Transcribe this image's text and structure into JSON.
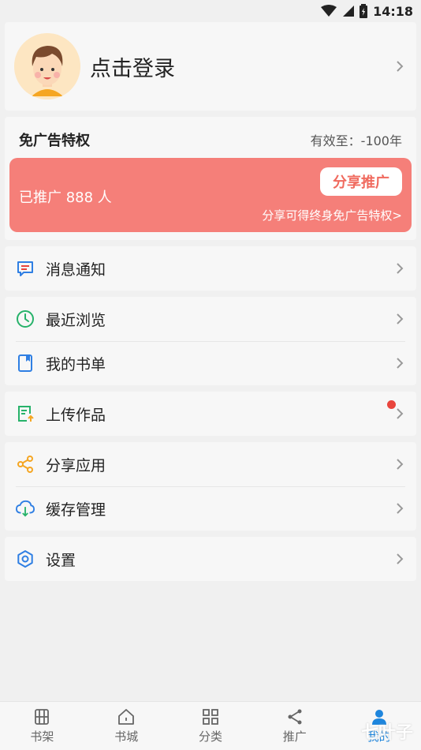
{
  "status": {
    "time": "14:18"
  },
  "profile": {
    "login_text": "点击登录"
  },
  "vip": {
    "title": "免广告特权",
    "valid": "有效至：-100年",
    "promoted_count": "已推广 888 人",
    "share_button": "分享推广",
    "hint": "分享可得终身免广告特权>"
  },
  "menu": {
    "notifications": "消息通知",
    "recent": "最近浏览",
    "booklist": "我的书单",
    "upload": "上传作品",
    "share_app": "分享应用",
    "cache": "缓存管理",
    "settings": "设置"
  },
  "tabs": [
    "书架",
    "书城",
    "分类",
    "推广",
    "我的"
  ],
  "watermark": "七叶子",
  "colors": {
    "accent": "#1f86dd",
    "promo_bg": "#f57f79",
    "badge": "#e9453d"
  }
}
